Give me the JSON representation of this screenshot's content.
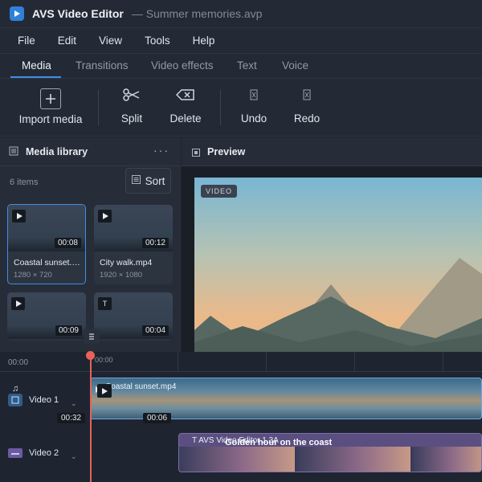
{
  "app": {
    "name": "AVS Video Editor",
    "document_title": "— Summer memories.avp",
    "accent_color": "#3d8fe6"
  },
  "menu": [
    "File",
    "Edit",
    "View",
    "Tools",
    "Help"
  ],
  "tabs": [
    {
      "label": "Media",
      "active": true
    },
    {
      "label": "Transitions",
      "active": false
    },
    {
      "label": "Video effects",
      "active": false
    },
    {
      "label": "Text",
      "active": false
    },
    {
      "label": "Voice",
      "active": false
    }
  ],
  "toolbar": {
    "import": {
      "label": "Import media",
      "icon": "plus-icon"
    },
    "split": {
      "label": "Split",
      "icon": "scissors-icon"
    },
    "delete": {
      "label": "Delete",
      "icon": "backspace-icon"
    },
    "undo": {
      "label": "Undo",
      "icon": "undo-icon"
    },
    "redo": {
      "label": "Redo",
      "icon": "redo-icon"
    }
  },
  "media_library": {
    "title": "Media library",
    "count_text": "6 items",
    "sort_label": "Sort",
    "items": [
      {
        "name": "Coastal sunset.mp4",
        "resolution": "1280 × 720",
        "duration": "00:08",
        "kind": "video",
        "selected": true
      },
      {
        "name": "City walk.mp4",
        "resolution": "1920 × 1080",
        "duration": "00:12",
        "kind": "video",
        "selected": false
      },
      {
        "name": "",
        "resolution": "",
        "duration": "00:09",
        "kind": "video",
        "selected": false
      },
      {
        "name": "",
        "resolution": "",
        "duration": "00:04",
        "kind": "text",
        "badge": "T",
        "selected": false
      }
    ]
  },
  "preview": {
    "title": "Preview",
    "badge": "VIDEO"
  },
  "timeline": {
    "ruler": [
      "00:00",
      "00:00"
    ],
    "tracks": [
      {
        "name": "Video 1"
      },
      {
        "name": "Video 2"
      }
    ],
    "clip1": {
      "label": "Coastal sunset.mp4"
    },
    "clip2": {
      "label": "T  AVS Video Editor 1.3A",
      "badge": "T"
    },
    "caption": "Golden hour on the coast",
    "chips": [
      "00:32",
      "00:06"
    ],
    "playhead_color": "#e8625b"
  }
}
